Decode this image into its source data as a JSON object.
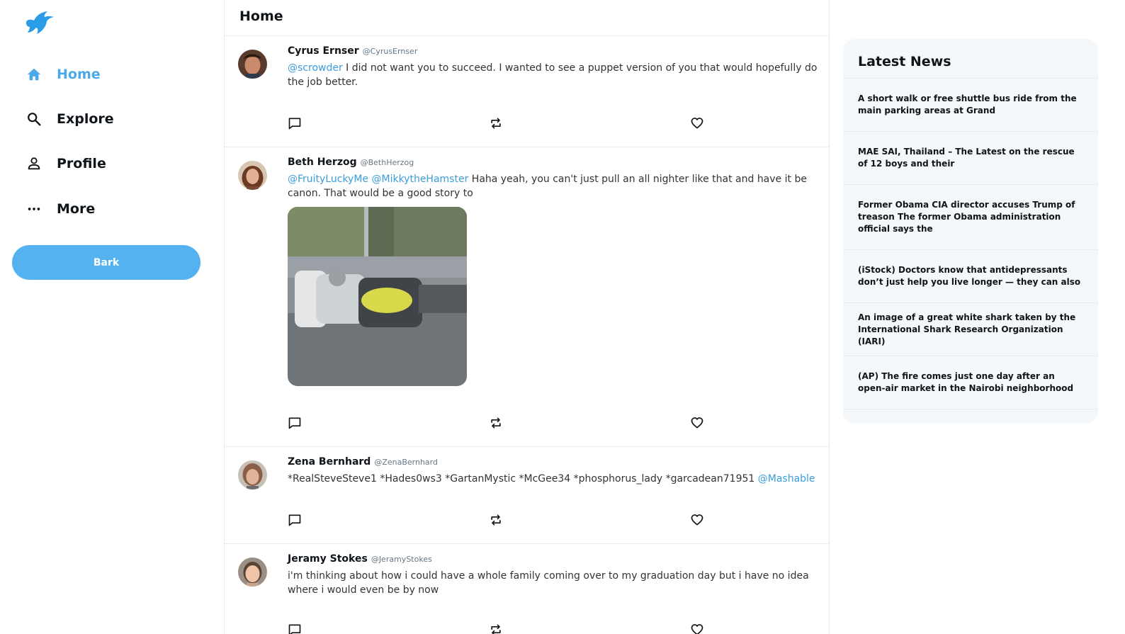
{
  "app": {
    "logo_icon": "bird-logo-icon",
    "brand_color": "#4ba9ea"
  },
  "sidebar": {
    "items": [
      {
        "label": "Home",
        "icon": "home-icon",
        "active": true
      },
      {
        "label": "Explore",
        "icon": "search-icon",
        "active": false
      },
      {
        "label": "Profile",
        "icon": "user-icon",
        "active": false
      },
      {
        "label": "More",
        "icon": "more-dots-icon",
        "active": false
      }
    ],
    "bark_label": "Bark"
  },
  "feed": {
    "title": "Home",
    "tweets": [
      {
        "name": "Cyrus Ernser",
        "handle": "@CyrusErnser",
        "mention": "@scrowder",
        "text": " I did not want you to succeed. I wanted to see a puppet version of you that would hopefully do the job better."
      },
      {
        "name": "Beth Herzog",
        "handle": "@BethHerzog",
        "mention": "@FruityLuckyMe @MikkytheHamster",
        "text": " Haha yeah, you can't just pull an all nighter like that and have it be canon. That would be a good story to",
        "has_image": true
      },
      {
        "name": "Zena Bernhard",
        "handle": "@ZenaBernhard",
        "text": "*RealSteveSteve1 *Hades0ws3 *GartanMystic *McGee34 *phosphorus_lady *garcadean71951 ",
        "mention_end": "@Mashable"
      },
      {
        "name": "Jeramy Stokes",
        "handle": "@JeramyStokes",
        "text": "i'm thinking about how i could have a whole family coming over to my graduation day but i have no idea where i would even be by now"
      }
    ]
  },
  "news": {
    "title": "Latest News",
    "items": [
      "A short walk or free shuttle bus ride from the main parking areas at Grand",
      "MAE SAI, Thailand – The Latest on the rescue of 12 boys and their",
      "Former Obama CIA director accuses Trump of treason The former Obama administration official says the",
      "(iStock) Doctors know that antidepressants don’t just help you live longer — they can also",
      "An image of a great white shark taken by the International Shark Research Organization (IARI)",
      "(AP) The fire comes just one day after an open-air market in the Nairobi neighborhood"
    ]
  }
}
